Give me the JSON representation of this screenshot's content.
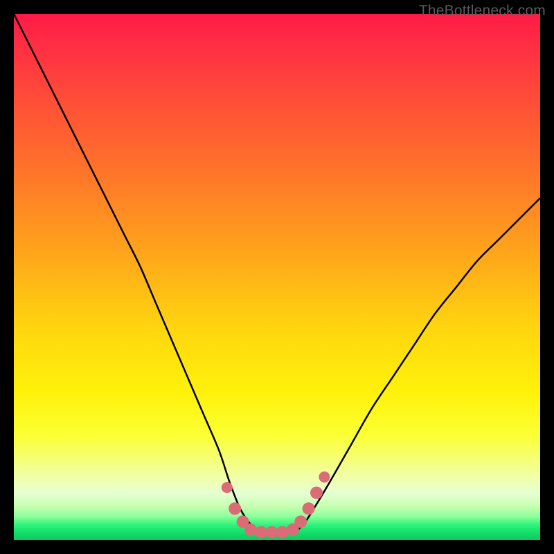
{
  "watermark": "TheBottleneck.com",
  "colors": {
    "page_bg": "#000000",
    "curve": "#000000",
    "marker_fill": "#db6b75",
    "gradient_top": "#ff1a46",
    "gradient_mid": "#fff20a",
    "gradient_bottom": "#0fc85f"
  },
  "chart_data": {
    "type": "line",
    "title": "",
    "xlabel": "",
    "ylabel": "",
    "xlim": [
      0,
      100
    ],
    "ylim": [
      0,
      100
    ],
    "grid": false,
    "legend": false,
    "series": [
      {
        "name": "bottleneck-curve",
        "x": [
          0,
          3,
          6,
          9,
          12,
          15,
          18,
          21,
          24,
          27,
          30,
          33,
          36,
          39,
          41,
          43,
          45,
          47,
          50,
          53,
          55,
          57,
          60,
          64,
          68,
          72,
          76,
          80,
          84,
          88,
          92,
          96,
          100
        ],
        "y": [
          100,
          94,
          88,
          82,
          76,
          70,
          64,
          58,
          52,
          45,
          38,
          31,
          24,
          17,
          11,
          6,
          3,
          1.5,
          1.5,
          1.5,
          3,
          6,
          11,
          18,
          25,
          31,
          37,
          43,
          48,
          53,
          57,
          61,
          65
        ]
      }
    ],
    "markers": [
      {
        "x": 40.5,
        "y": 10,
        "r": 8
      },
      {
        "x": 42,
        "y": 6,
        "r": 9
      },
      {
        "x": 43.5,
        "y": 3.5,
        "r": 9
      },
      {
        "x": 45,
        "y": 2,
        "r": 9
      },
      {
        "x": 47,
        "y": 1.5,
        "r": 9
      },
      {
        "x": 49,
        "y": 1.5,
        "r": 9
      },
      {
        "x": 51,
        "y": 1.5,
        "r": 9
      },
      {
        "x": 53,
        "y": 2,
        "r": 9
      },
      {
        "x": 54.5,
        "y": 3.5,
        "r": 9
      },
      {
        "x": 56,
        "y": 6,
        "r": 9
      },
      {
        "x": 57.5,
        "y": 9,
        "r": 9
      },
      {
        "x": 59,
        "y": 12,
        "r": 8
      }
    ]
  }
}
